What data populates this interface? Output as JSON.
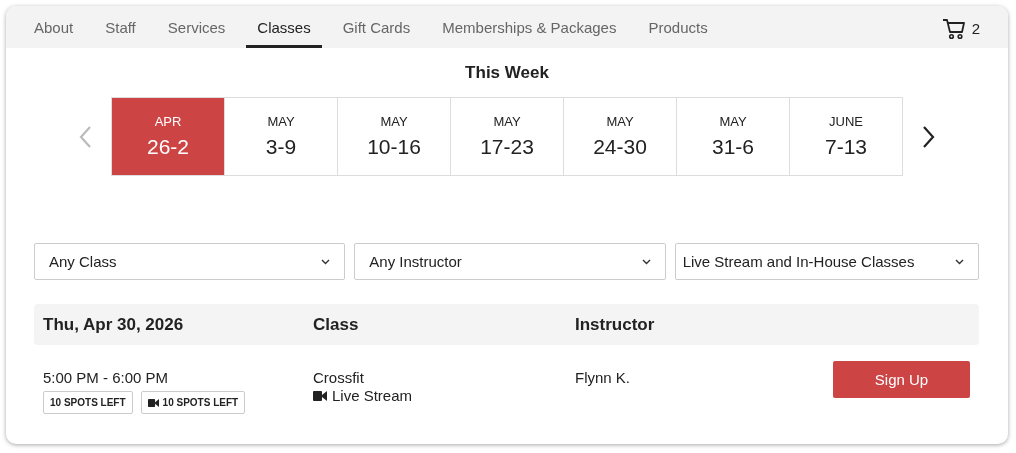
{
  "nav": {
    "tabs": [
      {
        "label": "About",
        "selected": false
      },
      {
        "label": "Staff",
        "selected": false
      },
      {
        "label": "Services",
        "selected": false
      },
      {
        "label": "Classes",
        "selected": true
      },
      {
        "label": "Gift Cards",
        "selected": false
      },
      {
        "label": "Memberships & Packages",
        "selected": false
      },
      {
        "label": "Products",
        "selected": false
      }
    ],
    "cart_count": "2"
  },
  "week_picker": {
    "title": "This Week",
    "prev_disabled": true,
    "next_disabled": false,
    "weeks": [
      {
        "month": "APR",
        "range": "26-2",
        "selected": true
      },
      {
        "month": "MAY",
        "range": "3-9",
        "selected": false
      },
      {
        "month": "MAY",
        "range": "10-16",
        "selected": false
      },
      {
        "month": "MAY",
        "range": "17-23",
        "selected": false
      },
      {
        "month": "MAY",
        "range": "24-30",
        "selected": false
      },
      {
        "month": "MAY",
        "range": "31-6",
        "selected": false
      },
      {
        "month": "JUNE",
        "range": "7-13",
        "selected": false
      }
    ]
  },
  "filters": [
    {
      "value": "Any Class"
    },
    {
      "value": "Any Instructor"
    },
    {
      "value": "Live Stream and In-House Classes"
    }
  ],
  "schedule": {
    "date": "Thu, Apr 30, 2026",
    "columns": [
      "Class",
      "Instructor"
    ],
    "sessions": [
      {
        "time": "5:00 PM - 6:00 PM",
        "spots": [
          {
            "kind": "in-house",
            "label": "10 SPOTS LEFT"
          },
          {
            "kind": "live-stream",
            "label": "10 SPOTS LEFT"
          }
        ],
        "class": "Crossfit",
        "mode": {
          "kind": "live-stream",
          "label": "Live Stream"
        },
        "instructor": "Flynn K.",
        "action": "Sign Up"
      }
    ]
  }
}
